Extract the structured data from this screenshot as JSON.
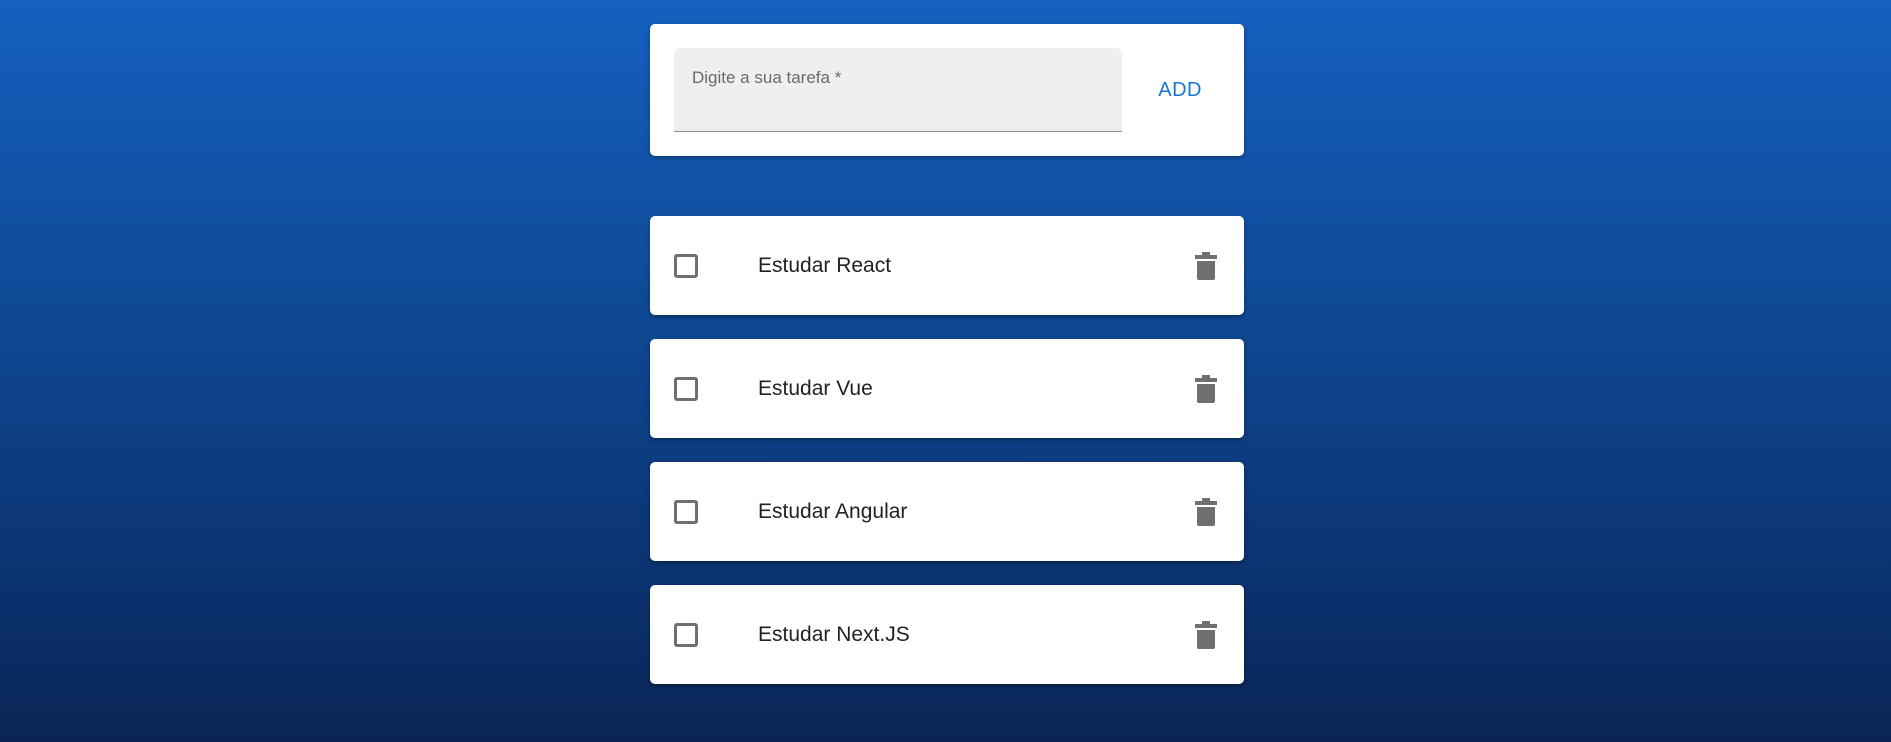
{
  "input": {
    "label": "Digite a sua tarefa *",
    "value": ""
  },
  "add_button": {
    "label": "ADD"
  },
  "tasks": [
    {
      "label": "Estudar React",
      "checked": false
    },
    {
      "label": "Estudar Vue",
      "checked": false
    },
    {
      "label": "Estudar Angular",
      "checked": false
    },
    {
      "label": "Estudar Next.JS",
      "checked": false
    }
  ],
  "icons": {
    "checkbox": "checkbox-unchecked-icon",
    "delete": "trash-icon"
  },
  "colors": {
    "accent": "#1976d2",
    "icon": "#6f6f6f",
    "background_top": "#1560c0",
    "background_bottom": "#0a2554"
  }
}
